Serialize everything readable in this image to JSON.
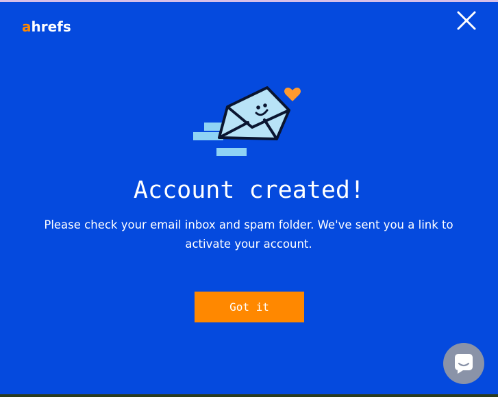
{
  "brand": {
    "logo_first": "a",
    "logo_rest": "hrefs",
    "accent_color": "#ff8800",
    "background_color": "#054ade"
  },
  "header": {
    "close_icon": "close-icon"
  },
  "illustration": {
    "icon": "smiling-envelope-with-heart-icon"
  },
  "dialog": {
    "title": "Account created!",
    "message": "Please check your email inbox and spam folder. We've sent you a link to activate your account.",
    "confirm_label": "Got it"
  },
  "chat_widget": {
    "icon": "chat-bubble-icon"
  }
}
